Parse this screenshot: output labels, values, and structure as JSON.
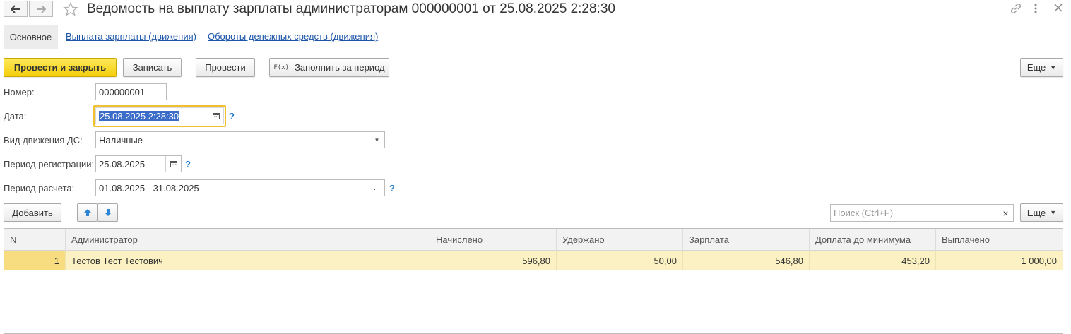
{
  "window": {
    "title": "Ведомость на выплату зарплаты администраторам 000000001 от 25.08.2025 2:28:30"
  },
  "tabs": {
    "main": "Основное",
    "salary_payment": "Выплата зарплаты (движения)",
    "cash_turnover": "Обороты денежных средств (движения)"
  },
  "toolbar": {
    "post_and_close": "Провести и закрыть",
    "save": "Записать",
    "post": "Провести",
    "fill_period": "Заполнить за период",
    "fill_icon_text": "F(x)",
    "more": "Еще"
  },
  "form": {
    "number_label": "Номер:",
    "number_value": "000000001",
    "date_label": "Дата:",
    "date_value": "25.08.2025  2:28:30",
    "movement_label": "Вид движения ДС:",
    "movement_value": "Наличные",
    "reg_period_label": "Период регистрации:",
    "reg_period_value": "25.08.2025",
    "calc_period_label": "Период расчета:",
    "calc_period_value": "01.08.2025 - 31.08.2025",
    "help": "?"
  },
  "table_toolbar": {
    "add": "Добавить",
    "search_placeholder": "Поиск (Ctrl+F)",
    "clear": "×",
    "more": "Еще"
  },
  "table": {
    "columns": [
      "N",
      "Администратор",
      "Начислено",
      "Удержано",
      "Зарплата",
      "Доплата до минимума",
      "Выплачено"
    ],
    "rows": [
      [
        "1",
        "Тестов Тест Тестович",
        "596,80",
        "50,00",
        "546,80",
        "453,20",
        "1 000,00"
      ]
    ]
  },
  "colors": {
    "primary_button": "#f3cf0c",
    "link": "#1c55a8",
    "selected_row": "#fbf1c2",
    "focus_border": "#f0c030"
  }
}
